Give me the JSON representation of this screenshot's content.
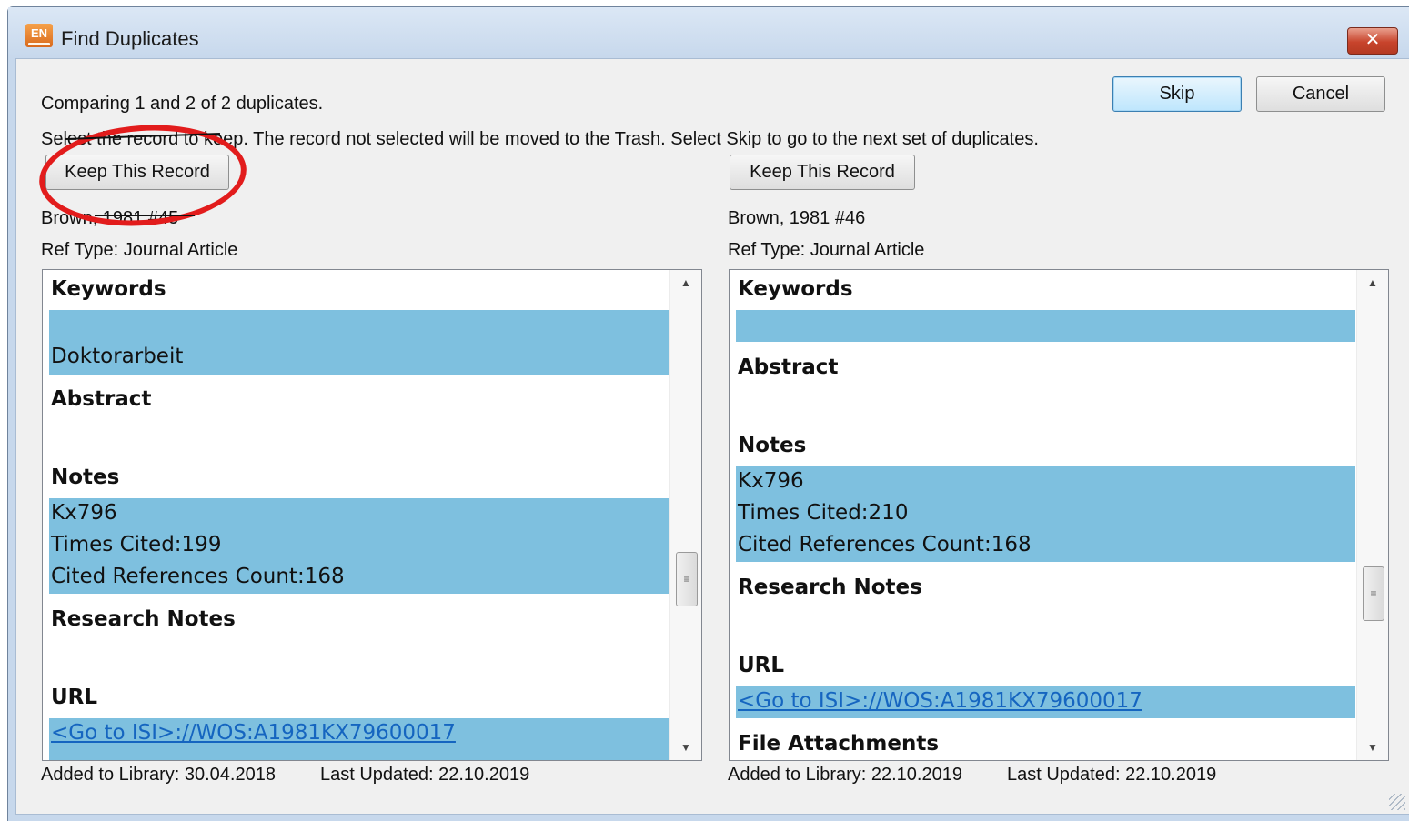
{
  "window": {
    "title": "Find Duplicates",
    "app_icon_text": "EN",
    "close_glyph": "✕"
  },
  "header": {
    "status": "Comparing 1 and 2 of 2 duplicates.",
    "instructions": "Select the record to keep. The record not selected will be moved to the Trash. Select Skip to go to the next set of duplicates.",
    "skip_label": "Skip",
    "cancel_label": "Cancel"
  },
  "left": {
    "keep_label": "Keep This Record",
    "ref_id": "Brown, 1981 #45",
    "ref_type": "Ref Type: Journal Article",
    "keywords_header": "Keywords",
    "keyword": "Doktorarbeit",
    "abstract_header": "Abstract",
    "notes_header": "Notes",
    "notes": [
      "Kx796",
      "Times Cited:199",
      "Cited References Count:168"
    ],
    "research_notes_header": "Research Notes",
    "url_header": "URL",
    "url": "<Go to ISI>://WOS:A1981KX79600017",
    "added": "Added to Library: 30.04.2018",
    "updated": "Last Updated: 22.10.2019"
  },
  "right": {
    "keep_label": "Keep This Record",
    "ref_id": "Brown, 1981 #46",
    "ref_type": "Ref Type: Journal Article",
    "keywords_header": "Keywords",
    "abstract_header": "Abstract",
    "notes_header": "Notes",
    "notes": [
      "Kx796",
      "Times Cited:210",
      "Cited References Count:168"
    ],
    "research_notes_header": "Research Notes",
    "url_header": "URL",
    "url": "<Go to ISI>://WOS:A1981KX79600017",
    "file_attachments_header": "File Attachments",
    "added": "Added to Library: 22.10.2019",
    "updated": "Last Updated: 22.10.2019"
  },
  "scroll": {
    "up_glyph": "▲",
    "down_glyph": "▼",
    "thumb_grip": "≡"
  },
  "colors": {
    "highlight": "#7ec0df",
    "annotation_ring": "#e21c1c",
    "link": "#1565c0"
  }
}
